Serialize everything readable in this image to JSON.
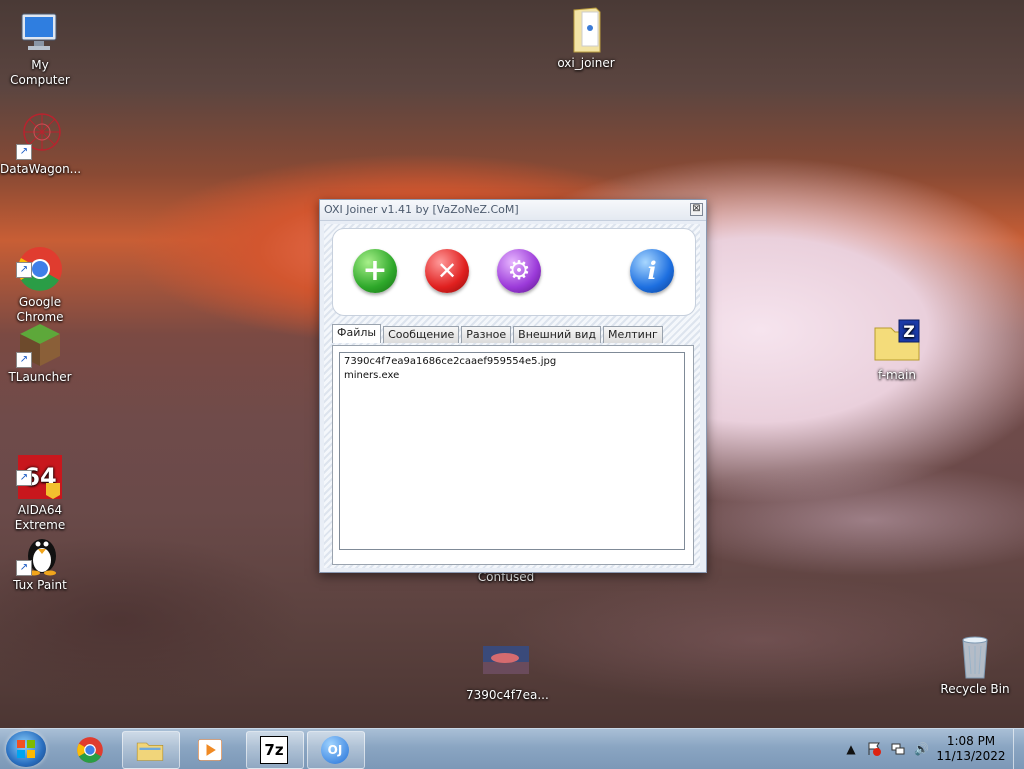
{
  "desktop": {
    "icons": [
      {
        "label": "My Computer"
      },
      {
        "label": "DataWagon..."
      },
      {
        "label": "Google\nChrome"
      },
      {
        "label": "TLauncher"
      },
      {
        "label": "AIDA64\nExtreme"
      },
      {
        "label": "Tux Paint"
      },
      {
        "label": "oxi_joiner"
      },
      {
        "label": "f-main"
      },
      {
        "label": "Confused"
      },
      {
        "label": "7390c4f7ea..."
      },
      {
        "label": "Recycle Bin"
      }
    ]
  },
  "window": {
    "title": "OXI Joiner v1.41 by [VaZoNeZ.CoM]",
    "close_glyph": "⊠",
    "toolbar": {
      "add_glyph": "+",
      "remove_glyph": "✕",
      "settings_glyph": "⚙",
      "info_glyph": "i"
    },
    "tabs": [
      "Файлы",
      "Сообщение",
      "Разное",
      "Внешний вид",
      "Мелтинг"
    ],
    "files": [
      "7390c4f7ea9a1686ce2caaef959554e5.jpg",
      "miners.exe"
    ]
  },
  "taskbar": {
    "clock_time": "1:08 PM",
    "clock_date": "11/13/2022",
    "buttons": [
      {
        "name": "chrome"
      },
      {
        "name": "explorer"
      },
      {
        "name": "media-player"
      },
      {
        "name": "7-zip",
        "text": "7z"
      },
      {
        "name": "oxi-joiner",
        "text": "OJ"
      }
    ],
    "tray": {
      "chevron": "▲",
      "volume": "🔊"
    }
  },
  "colors": {
    "taskbar": "#8aa5c2",
    "window_frame": "#8a99b2",
    "add_button": "#2ea82a",
    "remove_button": "#e0201f",
    "settings_button": "#9b3ad9",
    "info_button": "#1d6fe0"
  }
}
